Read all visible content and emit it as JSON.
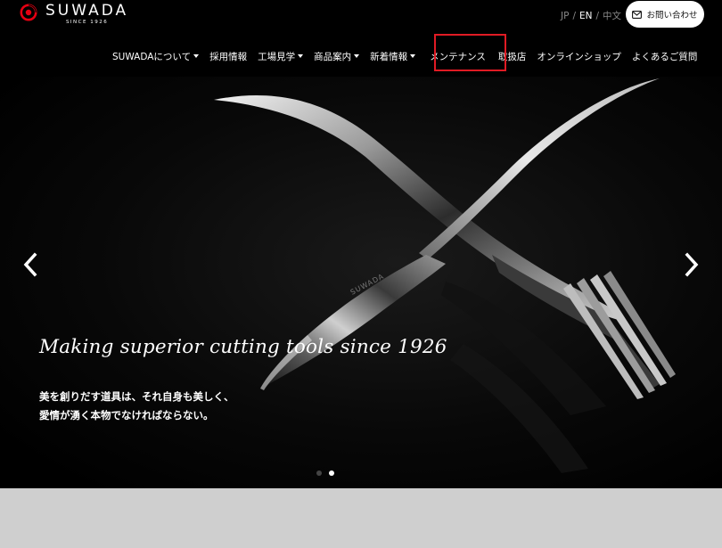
{
  "header": {
    "logo": {
      "name": "SUWADA",
      "since": "SINCE 1926"
    },
    "languages": [
      {
        "label": "JP",
        "active": false
      },
      {
        "label": "EN",
        "active": true
      },
      {
        "label": "中文",
        "active": false
      }
    ],
    "contact_label": "お問い合わせ",
    "nav": [
      {
        "label": "SUWADAについて",
        "dropdown": true
      },
      {
        "label": "採用情報",
        "dropdown": false
      },
      {
        "label": "工場見学",
        "dropdown": true
      },
      {
        "label": "商品案内",
        "dropdown": true
      },
      {
        "label": "新着情報",
        "dropdown": true
      },
      {
        "label": "メンテナンス",
        "dropdown": false
      },
      {
        "label": "取扱店",
        "dropdown": false
      },
      {
        "label": "オンラインショップ",
        "dropdown": false
      },
      {
        "label": "よくあるご質問",
        "dropdown": false
      }
    ]
  },
  "hero": {
    "tagline": "Making superior cutting tools since 1926",
    "subtext_line1": "美を創りだす道具は、それ自身も美しく、",
    "subtext_line2": "愛情が湧く本物でなければならない。",
    "blade_engraving": "SUWADA",
    "slides_total": 2,
    "active_slide": 2
  },
  "colors": {
    "brand_red": "#e60012",
    "highlight": "#e01b24",
    "background": "#000000",
    "footer_band": "#cfcfcf"
  },
  "icons": {
    "contact": "envelope-icon",
    "prev": "chevron-left-icon",
    "next": "chevron-right-icon",
    "nav_dropdown": "caret-down-icon"
  }
}
